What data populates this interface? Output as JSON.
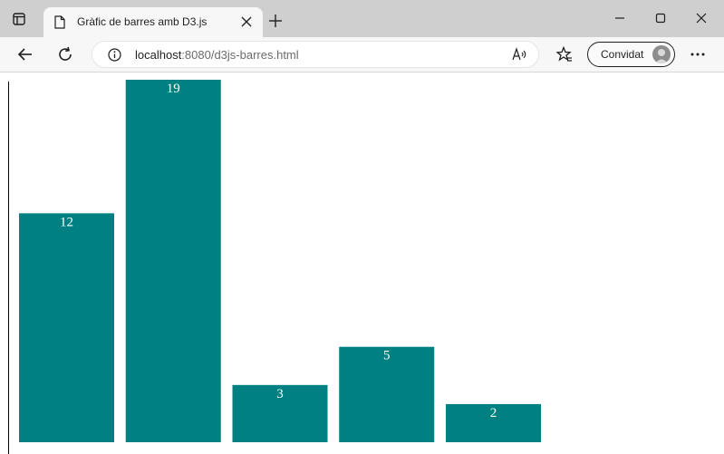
{
  "browser": {
    "tab_title": "Gràfic de barres amb D3.js",
    "url_host": "localhost",
    "url_rest": ":8080/d3js-barres.html",
    "profile_label": "Convidat"
  },
  "colors": {
    "bar": "#008080",
    "bar_label": "#ffffff",
    "axis": "#000000"
  },
  "chart_data": {
    "type": "bar",
    "categories": [
      "",
      "",
      "",
      "",
      ""
    ],
    "values": [
      12,
      19,
      3,
      5,
      2
    ],
    "ylim": [
      0,
      19
    ],
    "grid": false,
    "title": "",
    "xlabel": "",
    "ylabel": ""
  }
}
